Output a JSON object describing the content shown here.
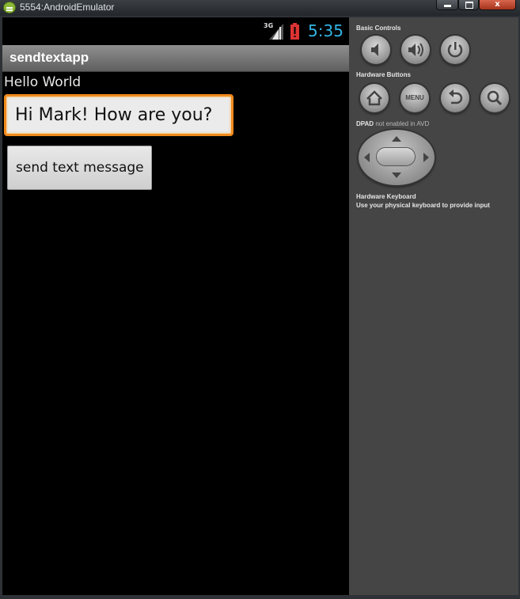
{
  "window": {
    "title": "5554:AndroidEmulator",
    "minimize_label": "",
    "maximize_label": "",
    "close_label": "x"
  },
  "status_bar": {
    "network": "3G",
    "time": "5:35"
  },
  "app": {
    "title": "sendtextapp",
    "hello_text": "Hello World",
    "message_value": "Hi Mark! How are you?",
    "send_button_label": "send text message"
  },
  "controls": {
    "basic_title": "Basic Controls",
    "hardware_buttons_title": "Hardware Buttons",
    "menu_label": "MENU",
    "dpad_title": "DPAD",
    "dpad_note": "not enabled in AVD",
    "keyboard_title": "Hardware Keyboard",
    "keyboard_desc": "Use your physical keyboard to provide input"
  },
  "colors": {
    "accent_clock": "#33b5e5",
    "focus_border": "#f18a1c",
    "panel_bg": "#454545"
  }
}
